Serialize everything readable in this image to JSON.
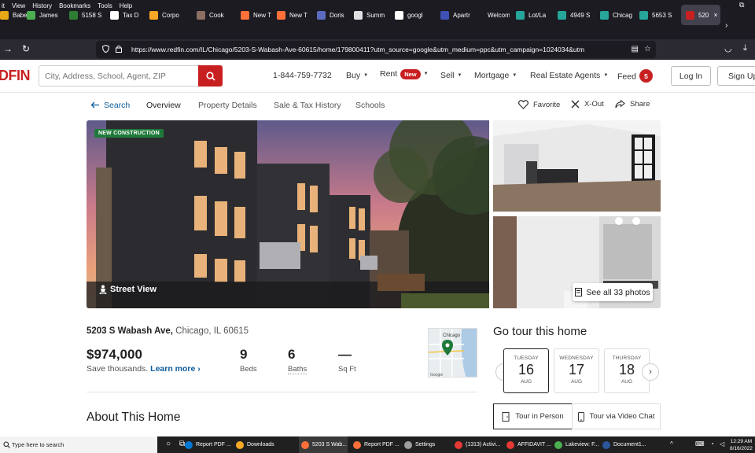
{
  "browser": {
    "menu": [
      "it",
      "View",
      "History",
      "Bookmarks",
      "Tools",
      "Help"
    ],
    "tabs": [
      {
        "label": "Babet",
        "color": "#e6a817"
      },
      {
        "label": "James",
        "color": "#4caf50"
      },
      {
        "label": "5158 S",
        "color": "#2e7d32"
      },
      {
        "label": "Tax D",
        "color": "#ffffff"
      },
      {
        "label": "Corpo",
        "color": "#f9a825"
      },
      {
        "label": "Cook",
        "color": "#8d6e63"
      },
      {
        "label": "New T",
        "color": "#ff7139"
      },
      {
        "label": "New T",
        "color": "#ff7139"
      },
      {
        "label": "Doris",
        "color": "#5c6bc0"
      },
      {
        "label": "Summ",
        "color": "#e0e0e0"
      },
      {
        "label": "googl",
        "color": "#ffffff"
      },
      {
        "label": "Apartr",
        "color": "#3f51b5"
      },
      {
        "label": "Welcome",
        "color": "#1c1b22"
      },
      {
        "label": "Lot/La",
        "color": "#26a69a"
      },
      {
        "label": "4949 S",
        "color": "#26a69a"
      },
      {
        "label": "Chicag",
        "color": "#26a69a"
      },
      {
        "label": "5653 S",
        "color": "#26a69a"
      },
      {
        "label": "520",
        "color": "#c82021"
      }
    ],
    "url": "https://www.redfin.com/IL/Chicago/5203-S-Wabash-Ave-60615/home/179800411?utm_source=google&utm_medium=ppc&utm_campaign=1024034&utm",
    "tab_close": "×",
    "tab_more": "›",
    "win_min": "—",
    "win_restore": "⧉"
  },
  "header": {
    "logo": "DFIN",
    "search_placeholder": "City, Address, School, Agent, ZIP",
    "phone": "1-844-759-7732",
    "nav": {
      "buy": "Buy",
      "rent": "Rent",
      "rent_badge": "New",
      "sell": "Sell",
      "mortgage": "Mortgage",
      "agents": "Real Estate Agents",
      "feed": "Feed",
      "feed_count": "5"
    },
    "login": "Log In",
    "signup": "Sign Up"
  },
  "subnav": {
    "search": "Search",
    "overview": "Overview",
    "property_details": "Property Details",
    "sale_tax": "Sale & Tax History",
    "schools": "Schools",
    "favorite": "Favorite",
    "xout": "X-Out",
    "share": "Share"
  },
  "photos": {
    "badge": "NEW CONSTRUCTION",
    "street_view": "Street View",
    "see_all": "See all 33 photos"
  },
  "listing": {
    "street": "5203 S Wabash Ave,",
    "city": "Chicago, IL 60615",
    "price": "$974,000",
    "save_text": "Save thousands.",
    "learn_more": "Learn more",
    "beds": "9",
    "beds_label": "Beds",
    "baths": "6",
    "baths_label": "Baths",
    "sqft": "—",
    "sqft_label": "Sq Ft",
    "map_label": "Chicago",
    "map_credit": "Google",
    "about": "About This Home"
  },
  "tour": {
    "title": "Go tour this home",
    "dates": [
      {
        "dow": "TUESDAY",
        "day": "16",
        "mon": "AUG"
      },
      {
        "dow": "WEDNESDAY",
        "day": "17",
        "mon": "AUG"
      },
      {
        "dow": "THURSDAY",
        "day": "18",
        "mon": "AUG"
      }
    ],
    "in_person": "Tour in Person",
    "video_chat": "Tour via Video Chat",
    "prev": "‹",
    "next": "›"
  },
  "taskbar": {
    "search": "Type here to search",
    "apps": [
      {
        "label": "Report PDF ...",
        "color": "#0078d4"
      },
      {
        "label": "Downloads",
        "color": "#f9a825"
      },
      {
        "label": "5203 S Wab...",
        "color": "#ff7139"
      },
      {
        "label": "Report PDF ...",
        "color": "#ff7139"
      },
      {
        "label": "Settings",
        "color": "#9e9e9e"
      },
      {
        "label": "(1313) Activi...",
        "color": "#e53935"
      },
      {
        "label": "AFFIDAVIT ...",
        "color": "#e53935"
      },
      {
        "label": "Lakeview: F...",
        "color": "#4caf50"
      },
      {
        "label": "Document1...",
        "color": "#2b579a"
      }
    ],
    "time": "12:29 AM",
    "date": "8/16/2022"
  }
}
